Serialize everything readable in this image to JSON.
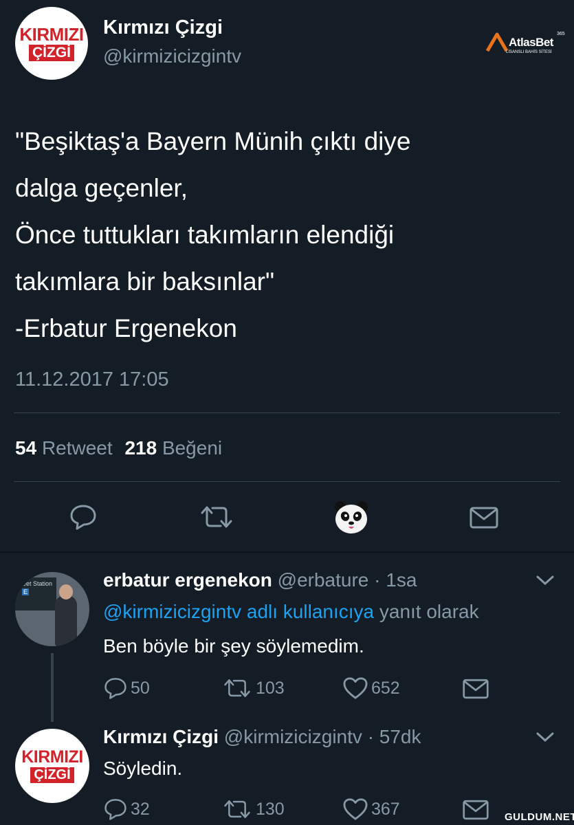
{
  "watermark_top": {
    "brand": "AtlasBet",
    "tagline": "LİSANSLI BAHİS SİTESİ",
    "badge": "365"
  },
  "watermark_bottom": "GULDUM.NET",
  "main_tweet": {
    "avatar": {
      "line1": "KIRMIZI",
      "line2": "ÇİZGİ"
    },
    "display_name": "Kırmızı Çizgi",
    "handle": "@kirmizicizgintv",
    "text_lines": [
      "\"Beşiktaş'a Bayern Münih çıktı diye",
      "dalga geçenler,",
      "Önce tuttukları takımların elendiği",
      "takımlara bir baksınlar\"",
      "-Erbatur Ergenekon"
    ],
    "timestamp": "11.12.2017 17:05",
    "retweet_count": "54",
    "retweet_label": "Retweet",
    "like_count": "218",
    "like_label": "Beğeni",
    "actions": [
      "reply-icon",
      "retweet-icon",
      "panda-icon",
      "message-icon"
    ]
  },
  "replies": [
    {
      "display_name": "erbatur ergenekon",
      "handle": "@erbature",
      "time": "· 1sa",
      "reply_to_link": "@kirmizicizgintv adlı kullanıcıya",
      "reply_to_suffix": "yanıt olarak",
      "text": "Ben böyle bir şey söylemedim.",
      "avatar_sign": {
        "line1": "reet Station",
        "line2": "E"
      },
      "reply_count": "50",
      "retweet_count": "103",
      "like_count": "652"
    },
    {
      "display_name": "Kırmızı Çizgi",
      "handle": "@kirmizicizgintv",
      "time": "· 57dk",
      "text": "Söyledin.",
      "avatar": {
        "line1": "KIRMIZI",
        "line2": "ÇİZGİ"
      },
      "reply_count": "32",
      "retweet_count": "130",
      "like_count": "367"
    }
  ],
  "colors": {
    "background": "#141d26",
    "muted": "#8899a6",
    "link": "#1da1f2",
    "brand_red": "#d2232a",
    "divider": "#38444d"
  }
}
